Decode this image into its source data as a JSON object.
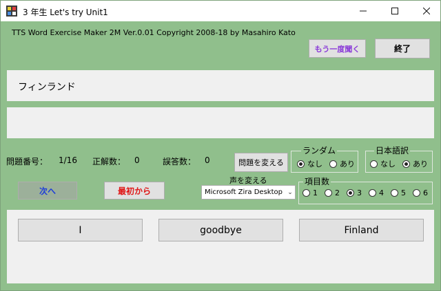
{
  "window": {
    "title": "3 年生 Let's try Unit1"
  },
  "header": {
    "copyright": "TTS Word Exercise Maker 2M Ver.0.01 Copyright 2008-18 by Masahiro Kato"
  },
  "buttons": {
    "repeat": "もう一度聞く",
    "end": "終了",
    "change_question": "問題を変える",
    "next": "次へ",
    "restart": "最初から"
  },
  "question": {
    "text": "フィンランド",
    "answer": ""
  },
  "stats": {
    "question_no_label": "問題番号：",
    "question_no_value": "1/16",
    "correct_label": "正解数：",
    "correct_value": "0",
    "wrong_label": "誤答数：",
    "wrong_value": "0"
  },
  "random": {
    "label": "ランダム",
    "options": [
      "なし",
      "あり"
    ],
    "selected": "なし"
  },
  "japanese": {
    "label": "日本語訳",
    "options": [
      "なし",
      "あり"
    ],
    "selected": "あり"
  },
  "items": {
    "label": "項目数",
    "options": [
      "1",
      "2",
      "3",
      "4",
      "5",
      "6"
    ],
    "selected": "3"
  },
  "voice": {
    "label": "声を変える",
    "selected": "Microsoft Zira Desktop"
  },
  "choices": [
    "I",
    "goodbye",
    "Finland"
  ]
}
